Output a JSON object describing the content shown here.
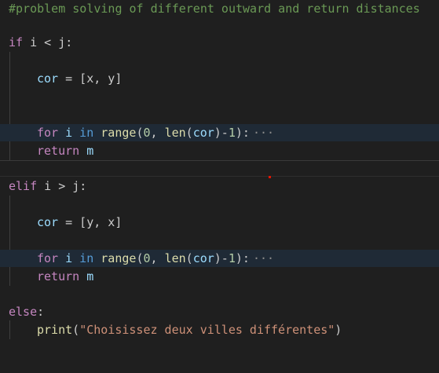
{
  "editor": {
    "comment": "#problem solving of different outward and return distances",
    "lines": {
      "if_kw": "if",
      "if_cond": " i < j:",
      "cor1_var": "cor",
      "cor1_rest": " = [x, y]",
      "for_kw": "for",
      "for_var": " i",
      "in_kw": " in",
      "range_fn": " range",
      "range_open": "(",
      "range_zero": "0",
      "range_mid": ", ",
      "len_fn": "len",
      "len_open": "(",
      "len_arg": "cor",
      "len_close": ")-",
      "range_one": "1",
      "range_close": "):",
      "fold": "···",
      "return_kw": "return",
      "return_val": " m",
      "elif_kw": "elif",
      "elif_cond": " i > j:",
      "cor2_var": "cor",
      "cor2_rest": " = [y, x]",
      "else_kw": "else",
      "else_colon": ":",
      "print_fn": "print",
      "print_open": "(",
      "print_str": "\"Choisissez deux villes différentes\"",
      "print_close": ")"
    }
  },
  "colors": {
    "background": "#1f1f1f",
    "line_highlight": "#1f2a36",
    "keyword_control": "#c586c0",
    "keyword": "#569cd6",
    "function": "#dcdcaa",
    "variable": "#9cdcfe",
    "number": "#b5cea8",
    "string": "#ce9178",
    "comment": "#6a9955"
  }
}
